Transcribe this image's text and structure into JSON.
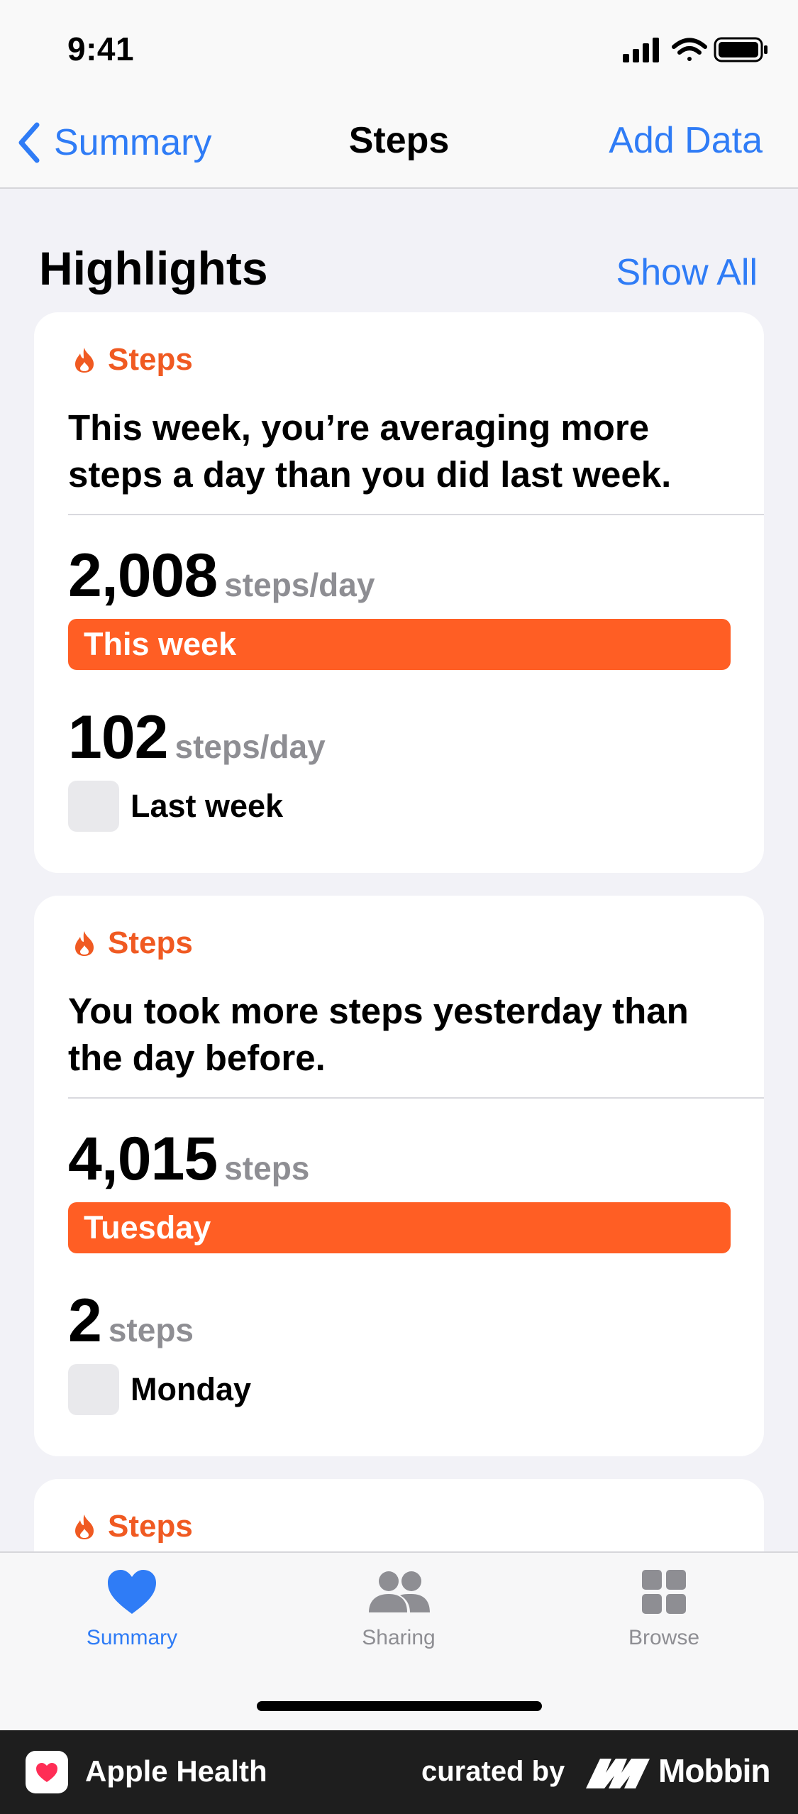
{
  "status_bar": {
    "time": "9:41"
  },
  "nav": {
    "back_label": "Summary",
    "title": "Steps",
    "action_label": "Add Data"
  },
  "section": {
    "title": "Highlights",
    "show_all_label": "Show All"
  },
  "colors": {
    "accent": "#2f7cf6",
    "steps": "#f05a22",
    "bar": "#ff5e24",
    "muted_bar": "#e9e9ec"
  },
  "cards": [
    {
      "category": "Steps",
      "text": "This week, you’re averaging more steps a day than you did last week.",
      "current": {
        "value": "2,008",
        "unit": "steps/day",
        "label": "This week"
      },
      "previous": {
        "value": "102",
        "unit": "steps/day",
        "label": "Last week"
      }
    },
    {
      "category": "Steps",
      "text": "You took more steps yesterday than the day before.",
      "current": {
        "value": "4,015",
        "unit": "steps",
        "label": "Tuesday"
      },
      "previous": {
        "value": "2",
        "unit": "steps",
        "label": "Monday"
      }
    },
    {
      "category": "Steps"
    }
  ],
  "tabs": [
    {
      "label": "Summary",
      "icon": "heart-icon",
      "active": true
    },
    {
      "label": "Sharing",
      "icon": "people-icon",
      "active": false
    },
    {
      "label": "Browse",
      "icon": "grid-icon",
      "active": false
    }
  ],
  "footer": {
    "app_name": "Apple Health",
    "curated_by": "curated by",
    "brand": "Mobbin"
  }
}
